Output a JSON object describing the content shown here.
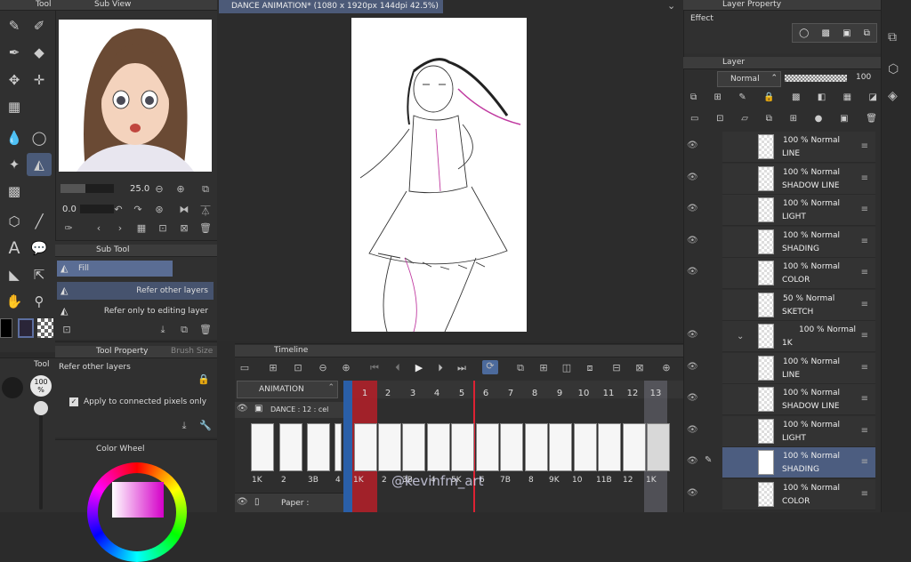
{
  "tool_panel": {
    "title": "Tool"
  },
  "sub_view": {
    "title": "Sub View",
    "zoom": "25.0",
    "rotation": "0.0"
  },
  "document_tab": {
    "title": "DANCE ANIMATION* (1080 x 1920px 144dpi 42.5%)"
  },
  "sub_tool": {
    "title": "Sub Tool",
    "items": [
      {
        "label": "Fill"
      },
      {
        "label": "Refer other layers"
      },
      {
        "label": "Refer only to editing layer"
      }
    ]
  },
  "tool_property": {
    "title": "Tool Property",
    "tab2": "Brush Size",
    "current": "Refer other layers",
    "option": "Apply to connected pixels only",
    "brush_percent": "100 %"
  },
  "color_wheel": {
    "title": "Color Wheel"
  },
  "left_strip": {
    "tool_label": "Tool"
  },
  "layer_property": {
    "title": "Layer Property",
    "effect": "Effect"
  },
  "layer_panel": {
    "title": "Layer",
    "blend": "Normal",
    "opacity": "100",
    "rows": [
      {
        "l1": "100 % Normal",
        "l2": "LINE"
      },
      {
        "l1": "100 % Normal",
        "l2": "SHADOW LINE"
      },
      {
        "l1": "100 % Normal",
        "l2": "LIGHT"
      },
      {
        "l1": "100 % Normal",
        "l2": "SHADING"
      },
      {
        "l1": "100 % Normal",
        "l2": "COLOR"
      },
      {
        "l1": "50 % Normal",
        "l2": "SKETCH"
      },
      {
        "l1": "100 % Normal",
        "l2": "1K"
      },
      {
        "l1": "100 % Normal",
        "l2": "LINE"
      },
      {
        "l1": "100 % Normal",
        "l2": "SHADOW LINE"
      },
      {
        "l1": "100 % Normal",
        "l2": "LIGHT"
      },
      {
        "l1": "100 % Normal",
        "l2": "SHADING"
      },
      {
        "l1": "100 % Normal",
        "l2": "COLOR"
      }
    ]
  },
  "timeline": {
    "title": "Timeline",
    "name": "ANIMATION",
    "track1": "DANCE : 12 : cel",
    "track2": "Paper :",
    "frame_numbers": [
      "1",
      "2",
      "3",
      "4",
      "5",
      "6",
      "7",
      "8",
      "9",
      "10",
      "11",
      "12",
      "13"
    ],
    "thumb_labels": [
      "1K",
      "2",
      "3B",
      "4"
    ],
    "cel_labels": [
      "1K",
      "2",
      "3B",
      "4",
      "5K",
      "6",
      "7B",
      "8",
      "9K",
      "10",
      "11B",
      "12",
      "1K"
    ],
    "watermark": "@kevinfm_art"
  }
}
